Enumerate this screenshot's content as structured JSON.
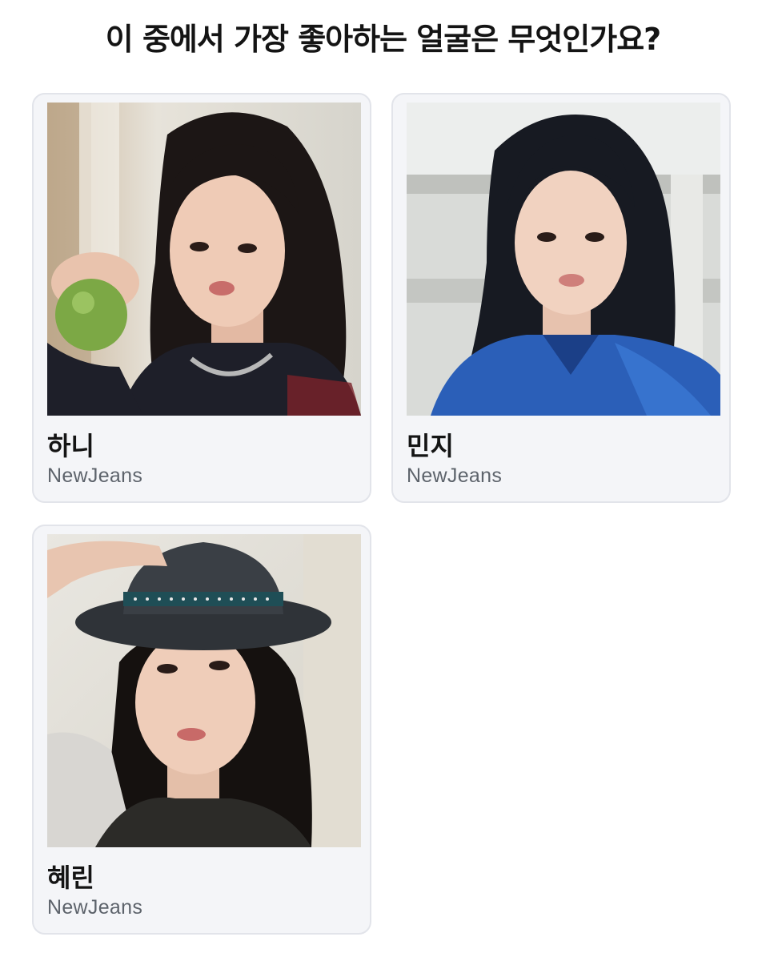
{
  "question": {
    "title": "이 중에서 가장 좋아하는 얼굴은 무엇인가요?"
  },
  "options": [
    {
      "name": "하니",
      "group": "NewJeans",
      "photo_icon": "portrait-photo-with-apple"
    },
    {
      "name": "민지",
      "group": "NewJeans",
      "photo_icon": "portrait-photo-blue-shirt"
    },
    {
      "name": "혜린",
      "group": "NewJeans",
      "photo_icon": "portrait-photo-with-hat"
    }
  ],
  "colors": {
    "card_background": "#f4f5f8",
    "card_border": "#e2e4ea",
    "title_text": "#141414",
    "subtitle_text": "#5d636b"
  }
}
